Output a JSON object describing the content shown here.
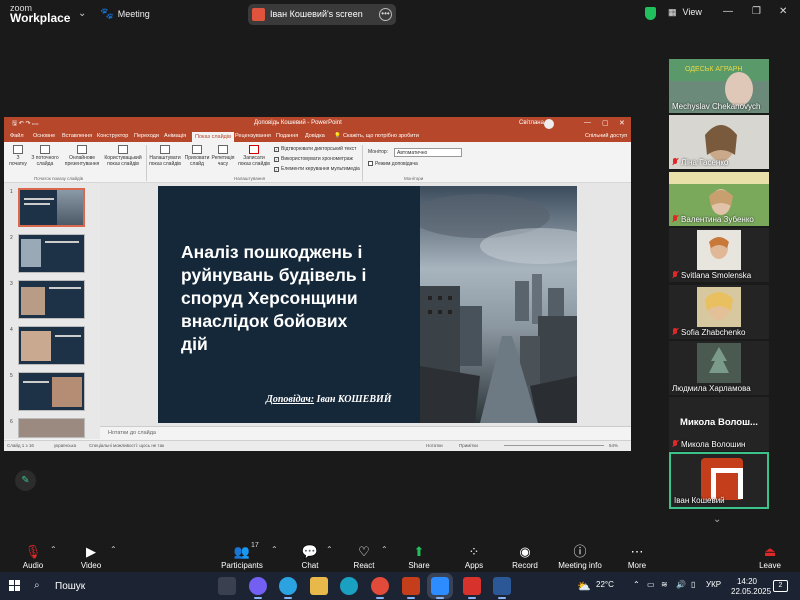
{
  "zoom": {
    "logo_line1": "zoom",
    "logo_line2": "Workplace",
    "meeting_label": "Meeting",
    "share_banner": "Іван Кошевий's screen",
    "view_label": "View",
    "colors": {
      "bg": "#1a1a1a",
      "green": "#3cc28b",
      "share_red": "#e0533d"
    }
  },
  "powerpoint": {
    "doc_title": "Доповідь Кошевий  -  PowerPoint",
    "user": "Світлана",
    "tabs": [
      "Файл",
      "Основне",
      "Вставлення",
      "Конструктор",
      "Переходи",
      "Анімація",
      "Показ слайдів",
      "Рецензування",
      "Подання",
      "Довідка",
      "Скажіть, що потрібно зробити"
    ],
    "active_tab": "Показ слайдів",
    "share_label": "Спільний доступ",
    "ribbon": {
      "from_start": "З початку",
      "from_current": "З поточного слайда",
      "online": "Онлайнове презентування",
      "custom": "Користувацький показ слайдів",
      "setup": "Налаштувати показ слайдів",
      "hide": "Приховати слайд",
      "rehearse": "Репетиція часу",
      "record": "Записати показ слайдів",
      "checkbox1": "Відтворювати дикторський текст",
      "checkbox2": "Використовувати хронометраж",
      "checkbox3": "Елементи керування мультимедіа",
      "monitor_label": "Монітор:",
      "monitor_value": "Автоматично",
      "presenter_view": "Режим доповідача",
      "group_start": "Початок показу слайдів",
      "group_setup": "Налаштування",
      "group_monitors": "Монітори"
    },
    "thumb_numbers": [
      "1",
      "2",
      "3",
      "4",
      "5",
      "6"
    ],
    "slide": {
      "title_lines": [
        "Аналіз пошкоджень і",
        "руйнувань будівель і",
        "споруд Херсонщини",
        "внаслідок бойових",
        "дій"
      ],
      "author_label": "Доповідач:",
      "author_name": "Іван КОШЕВИЙ"
    },
    "notes_placeholder": "Нотатки до слайда",
    "status": {
      "slide_info": "Слайд 1 з 16",
      "language": "українська",
      "accessibility": "Спеціальні можливості: щось не так",
      "notes_btn": "Нотатки",
      "comments_btn": "Примітки",
      "zoom": "54%"
    }
  },
  "participants": [
    {
      "name": "Mechyslav Chekanovych",
      "muted": false,
      "style": "video"
    },
    {
      "name": "Ліна Гасенко",
      "muted": true,
      "style": "video"
    },
    {
      "name": "Валентина Зубенко",
      "muted": true,
      "style": "video"
    },
    {
      "name": "Svitlana Smolenska",
      "muted": true,
      "style": "video"
    },
    {
      "name": "Sofia Zhabchenko",
      "muted": true,
      "style": "video"
    },
    {
      "name": "Людмила Харламова",
      "muted": false,
      "style": "video"
    },
    {
      "name": "Микола Волошин",
      "muted": true,
      "style": "name",
      "big_name": "Микола Волош..."
    },
    {
      "name": "Іван Кошевий",
      "muted": false,
      "style": "logo"
    }
  ],
  "toolbar": {
    "audio": "Audio",
    "video": "Video",
    "participants": "Participants",
    "participants_count": "17",
    "chat": "Chat",
    "react": "React",
    "share": "Share",
    "apps": "Apps",
    "record": "Record",
    "meeting_info": "Meeting info",
    "more": "More",
    "leave": "Leave"
  },
  "taskbar": {
    "search": "Пошук",
    "temperature": "22°C",
    "language": "УКР",
    "time": "14:20",
    "date": "22.05.2025",
    "notifications": "2"
  }
}
